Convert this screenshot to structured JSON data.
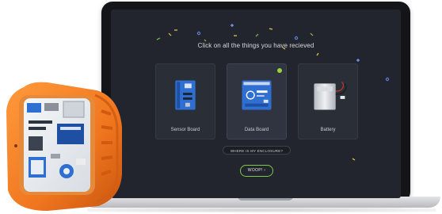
{
  "screen": {
    "heading": "Click on all the things you have recieved",
    "cards": [
      {
        "label": "Sensor Board",
        "selected": false
      },
      {
        "label": "Data Board",
        "selected": true
      },
      {
        "label": "Battery",
        "selected": false
      }
    ],
    "enclosure_link": "WHERE IS MY ENCLOSURE?",
    "action_button": "WOOP! ›"
  },
  "colors": {
    "screen_background": "#22252d",
    "accent_green": "#7ec84a",
    "board_blue": "#2f6fd1",
    "device_orange": "#f0761f"
  },
  "icons": [
    "check-icon",
    "sensor-board-icon",
    "data-board-icon",
    "battery-icon"
  ]
}
